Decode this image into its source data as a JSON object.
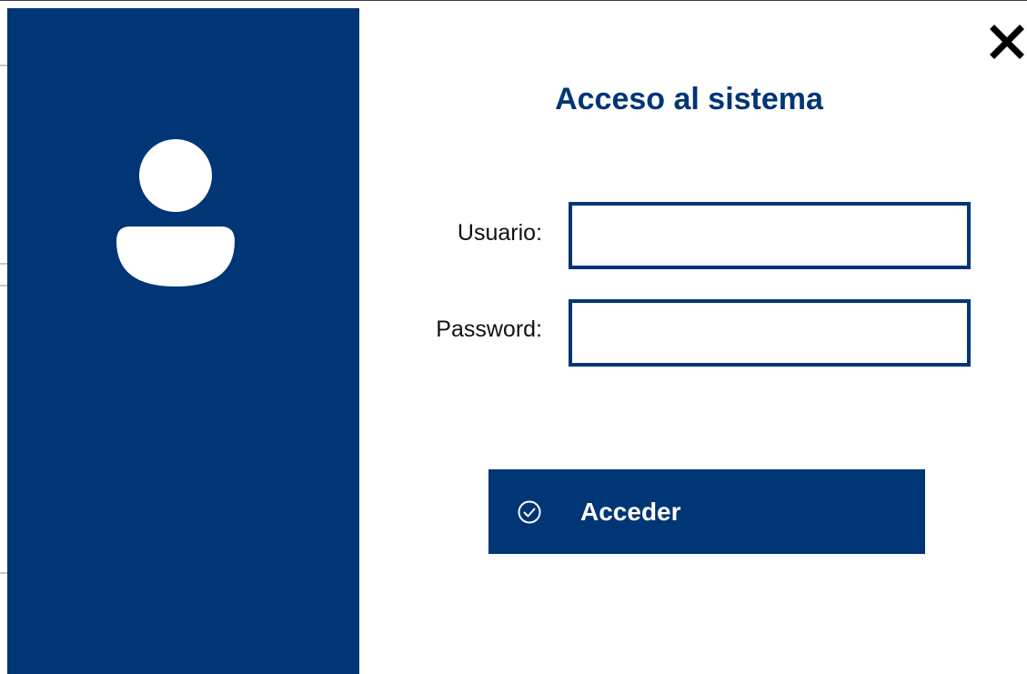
{
  "login": {
    "title": "Acceso al sistema",
    "username_label": "Usuario:",
    "username_value": "",
    "password_label": "Password:",
    "password_value": "",
    "submit_label": "Acceder"
  },
  "icons": {
    "avatar": "user-avatar-icon",
    "close": "close-icon",
    "submit": "check-circle-icon"
  },
  "colors": {
    "brand": "#003576",
    "background": "#ffffff",
    "text": "#111111"
  }
}
